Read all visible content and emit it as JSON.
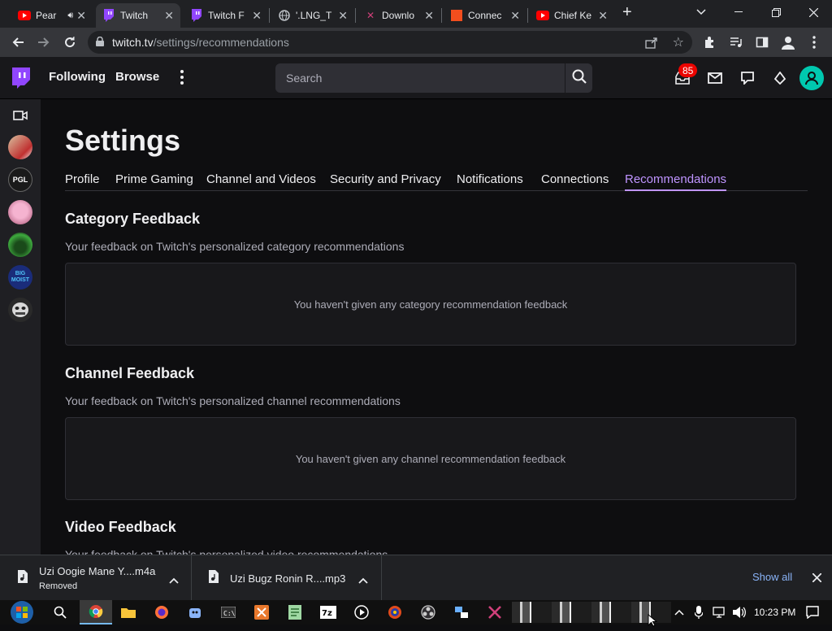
{
  "browser": {
    "tabs": [
      {
        "title": "Pear",
        "icon": "youtube-icon",
        "color": "#ff0000",
        "muted_icon": "speaker-icon"
      },
      {
        "title": "Twitch",
        "icon": "twitch-icon",
        "color": "#9146ff",
        "active": true
      },
      {
        "title": "Twitch F",
        "icon": "twitch-icon",
        "color": "#9146ff"
      },
      {
        "title": "'.LNG_T",
        "icon": "globe-icon",
        "color": "#bdc1c6"
      },
      {
        "title": "Downlo",
        "icon": "x-logo-icon",
        "color": "#d0407a"
      },
      {
        "title": "Connec",
        "icon": "square-icon",
        "color": "#f24e1e"
      },
      {
        "title": "Chief Ke",
        "icon": "youtube-icon",
        "color": "#ff0000"
      }
    ],
    "new_tab": "+",
    "url_domain": "twitch.tv",
    "url_path": "/settings/recommendations"
  },
  "twitch": {
    "nav": {
      "following": "Following",
      "browse": "Browse"
    },
    "search_placeholder": "Search",
    "notification_count": "85",
    "page_title": "Settings",
    "settings_tabs": [
      "Profile",
      "Prime Gaming",
      "Channel and Videos",
      "Security and Privacy",
      "Notifications",
      "Connections",
      "Recommendations"
    ],
    "active_tab": "Recommendations",
    "sections": [
      {
        "title": "Category Feedback",
        "subtitle": "Your feedback on Twitch's personalized category recommendations",
        "empty": "You haven't given any category recommendation feedback"
      },
      {
        "title": "Channel Feedback",
        "subtitle": "Your feedback on Twitch's personalized channel recommendations",
        "empty": "You haven't given any channel recommendation feedback"
      },
      {
        "title": "Video Feedback",
        "subtitle": "Your feedback on Twitch's personalized video recommendations"
      }
    ],
    "accent": "#bf94ff"
  },
  "downloads": {
    "items": [
      {
        "name": "Uzi Oogie Mane Y....m4a",
        "status": "Removed"
      },
      {
        "name": "Uzi Bugz Ronin R....mp3",
        "status": ""
      }
    ],
    "show_all": "Show all"
  },
  "taskbar": {
    "time": "10:23 PM"
  }
}
